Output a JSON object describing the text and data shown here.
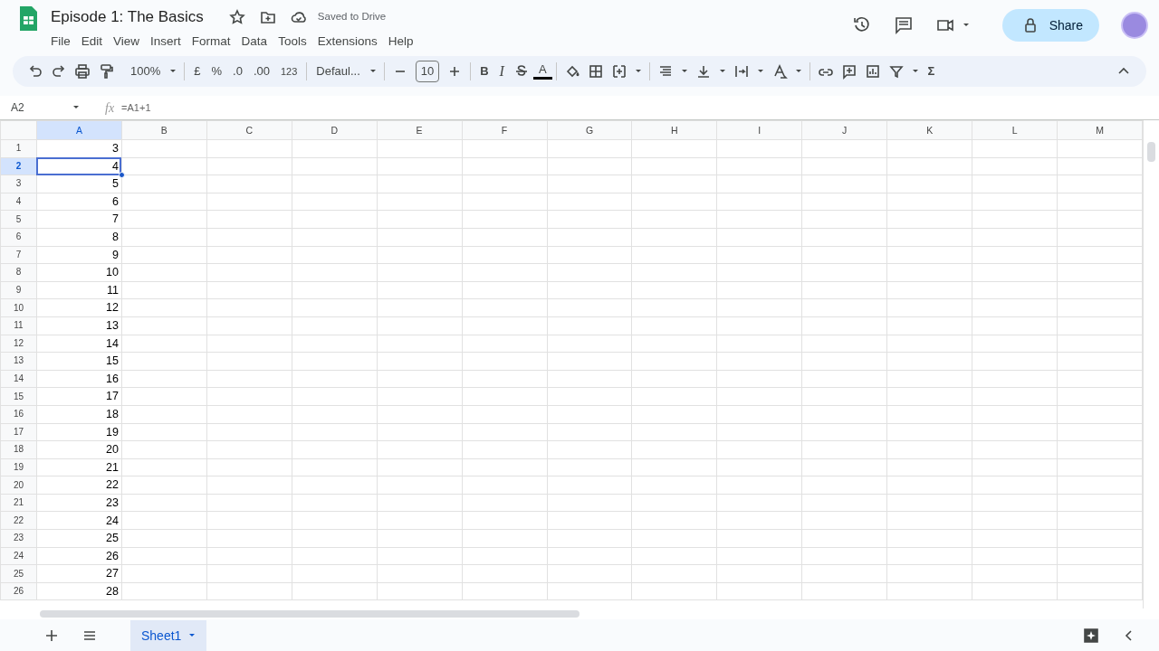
{
  "doc": {
    "title": "Episode 1: The Basics",
    "save_status": "Saved to Drive"
  },
  "menu": [
    "File",
    "Edit",
    "View",
    "Insert",
    "Format",
    "Data",
    "Tools",
    "Extensions",
    "Help"
  ],
  "share": {
    "label": "Share"
  },
  "toolbar": {
    "zoom": "100%",
    "currency": "£",
    "percent": "%",
    "dec_less": ".0",
    "dec_more": ".00",
    "number_format": "123",
    "font": "Defaul...",
    "font_size": "10",
    "bold": "B",
    "italic": "I",
    "text_color": "A",
    "functions": "Σ"
  },
  "formula_bar": {
    "cell_ref": "A2",
    "fx": "fx",
    "formula": "=A1+1"
  },
  "columns": [
    {
      "label": "A",
      "selected": true
    },
    {
      "label": "B",
      "selected": false
    },
    {
      "label": "C",
      "selected": false
    },
    {
      "label": "D",
      "selected": false
    },
    {
      "label": "E",
      "selected": false
    },
    {
      "label": "F",
      "selected": false
    },
    {
      "label": "G",
      "selected": false
    },
    {
      "label": "H",
      "selected": false
    },
    {
      "label": "I",
      "selected": false
    },
    {
      "label": "J",
      "selected": false
    },
    {
      "label": "K",
      "selected": false
    },
    {
      "label": "L",
      "selected": false
    },
    {
      "label": "M",
      "selected": false
    }
  ],
  "rows": [
    {
      "label": "1",
      "selected": false,
      "value": "3"
    },
    {
      "label": "2",
      "selected": true,
      "value": "4"
    },
    {
      "label": "3",
      "selected": false,
      "value": "5"
    },
    {
      "label": "4",
      "selected": false,
      "value": "6"
    },
    {
      "label": "5",
      "selected": false,
      "value": "7"
    },
    {
      "label": "6",
      "selected": false,
      "value": "8"
    },
    {
      "label": "7",
      "selected": false,
      "value": "9"
    },
    {
      "label": "8",
      "selected": false,
      "value": "10"
    },
    {
      "label": "9",
      "selected": false,
      "value": "11"
    },
    {
      "label": "10",
      "selected": false,
      "value": "12"
    },
    {
      "label": "11",
      "selected": false,
      "value": "13"
    },
    {
      "label": "12",
      "selected": false,
      "value": "14"
    },
    {
      "label": "13",
      "selected": false,
      "value": "15"
    },
    {
      "label": "14",
      "selected": false,
      "value": "16"
    },
    {
      "label": "15",
      "selected": false,
      "value": "17"
    },
    {
      "label": "16",
      "selected": false,
      "value": "18"
    },
    {
      "label": "17",
      "selected": false,
      "value": "19"
    },
    {
      "label": "18",
      "selected": false,
      "value": "20"
    },
    {
      "label": "19",
      "selected": false,
      "value": "21"
    },
    {
      "label": "20",
      "selected": false,
      "value": "22"
    },
    {
      "label": "21",
      "selected": false,
      "value": "23"
    },
    {
      "label": "22",
      "selected": false,
      "value": "24"
    },
    {
      "label": "23",
      "selected": false,
      "value": "25"
    },
    {
      "label": "24",
      "selected": false,
      "value": "26"
    },
    {
      "label": "25",
      "selected": false,
      "value": "27"
    },
    {
      "label": "26",
      "selected": false,
      "value": "28"
    }
  ],
  "sheets": [
    {
      "label": "Sheet1",
      "selected": true
    }
  ]
}
